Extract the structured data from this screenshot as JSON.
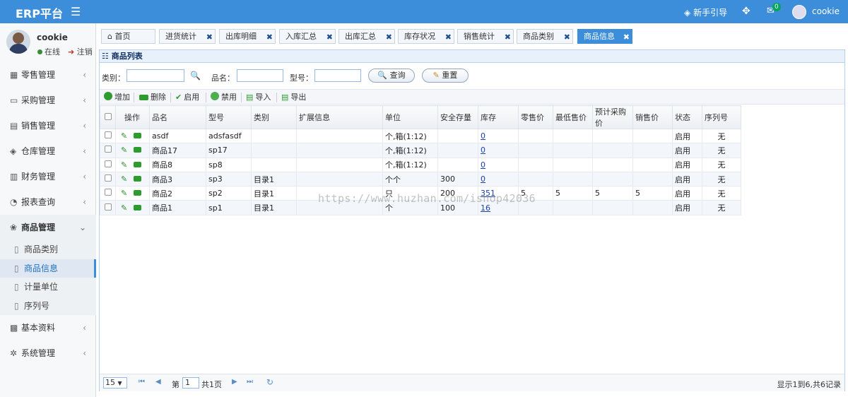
{
  "topbar": {
    "brand": "ERP平台",
    "guide": "新手引导",
    "mail_badge": "0",
    "user": "cookie"
  },
  "user_panel": {
    "name": "cookie",
    "status": "在线",
    "logout": "注销"
  },
  "nav": {
    "items": [
      {
        "label": "零售管理",
        "icon": "retail-icon"
      },
      {
        "label": "采购管理",
        "icon": "purchase-icon"
      },
      {
        "label": "销售管理",
        "icon": "sales-icon"
      },
      {
        "label": "仓库管理",
        "icon": "warehouse-icon"
      },
      {
        "label": "财务管理",
        "icon": "finance-icon"
      },
      {
        "label": "报表查询",
        "icon": "report-icon"
      },
      {
        "label": "商品管理",
        "icon": "goods-icon"
      },
      {
        "label": "基本资料",
        "icon": "basic-info-icon"
      },
      {
        "label": "系统管理",
        "icon": "system-icon"
      }
    ],
    "sub_items": [
      {
        "label": "商品类别"
      },
      {
        "label": "商品信息"
      },
      {
        "label": "计量单位"
      },
      {
        "label": "序列号"
      }
    ]
  },
  "tabs": [
    "首页",
    "进货统计",
    "出库明细",
    "入库汇总",
    "出库汇总",
    "库存状况",
    "销售统计",
    "商品类别",
    "商品信息"
  ],
  "panel": {
    "title": "商品列表"
  },
  "search": {
    "category_label": "类别：",
    "name_label": "品名：",
    "model_label": "型号：",
    "search_btn": "查询",
    "reset_btn": "重置"
  },
  "toolbar": {
    "add": "增加",
    "delete": "删除",
    "enable": "启用",
    "disable": "禁用",
    "import": "导入",
    "export": "导出"
  },
  "columns": [
    "操作",
    "品名",
    "型号",
    "类别",
    "扩展信息",
    "单位",
    "安全存量",
    "库存",
    "零售价",
    "最低售价",
    "预计采购价",
    "销售价",
    "状态",
    "序列号"
  ],
  "rows": [
    {
      "name": "asdf",
      "model": "adsfasdf",
      "category": "",
      "ext": "",
      "unit": "个,箱(1:12)",
      "safety": "",
      "stock": "0",
      "retail": "",
      "min_price": "",
      "purchase": "",
      "sale": "",
      "status": "启用",
      "serial": "无"
    },
    {
      "name": "商品17",
      "model": "sp17",
      "category": "",
      "ext": "",
      "unit": "个,箱(1:12)",
      "safety": "",
      "stock": "0",
      "retail": "",
      "min_price": "",
      "purchase": "",
      "sale": "",
      "status": "启用",
      "serial": "无"
    },
    {
      "name": "商品8",
      "model": "sp8",
      "category": "",
      "ext": "",
      "unit": "个,箱(1:12)",
      "safety": "",
      "stock": "0",
      "retail": "",
      "min_price": "",
      "purchase": "",
      "sale": "",
      "status": "启用",
      "serial": "无"
    },
    {
      "name": "商品3",
      "model": "sp3",
      "category": "目录1",
      "ext": "",
      "unit": "个个",
      "safety": "300",
      "stock": "0",
      "retail": "",
      "min_price": "",
      "purchase": "",
      "sale": "",
      "status": "启用",
      "serial": "无"
    },
    {
      "name": "商品2",
      "model": "sp2",
      "category": "目录1",
      "ext": "",
      "unit": "只",
      "safety": "200",
      "stock": "351",
      "retail": "5",
      "min_price": "5",
      "purchase": "5",
      "sale": "5",
      "status": "启用",
      "serial": "无"
    },
    {
      "name": "商品1",
      "model": "sp1",
      "category": "目录1",
      "ext": "",
      "unit": "个",
      "safety": "100",
      "stock": "16",
      "retail": "",
      "min_price": "",
      "purchase": "",
      "sale": "",
      "status": "启用",
      "serial": "无"
    }
  ],
  "pager": {
    "page_size": "15",
    "page_prefix": "第",
    "page_value": "1",
    "page_suffix": "共1页",
    "info": "显示1到6,共6记录"
  },
  "watermark": "https://www.huzhan.com/ishop42036"
}
